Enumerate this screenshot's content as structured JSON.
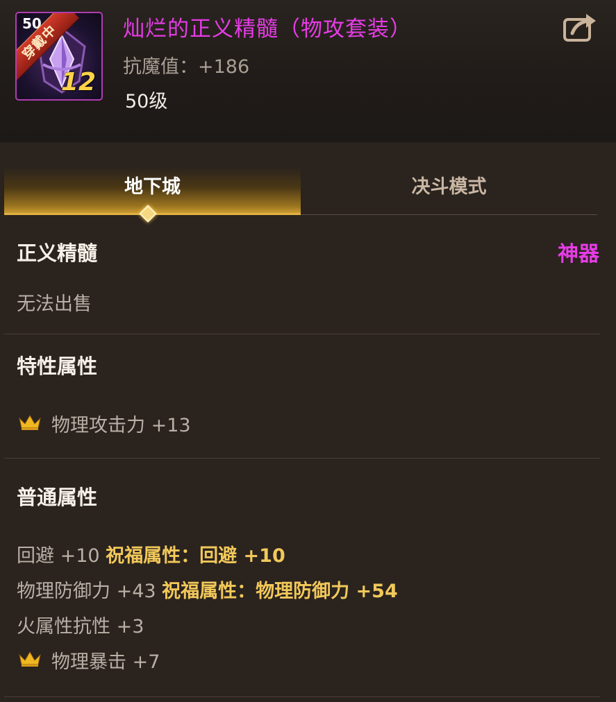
{
  "item": {
    "icon_level_top": "50",
    "equipped_badge": "穿戴中",
    "enhance_level": "12",
    "name": "灿烂的正义精髓（物攻套装）",
    "magic_resist": "抗魔值：+186",
    "required_level": "50级"
  },
  "tabs": [
    {
      "label": "地下城",
      "active": true
    },
    {
      "label": "决斗模式",
      "active": false
    }
  ],
  "detail": {
    "type_name": "正义精髓",
    "rarity": "神器",
    "sell_status": "无法出售"
  },
  "special_attributes": {
    "title": "特性属性",
    "items": [
      {
        "text": "物理攻击力 +13",
        "icon": "crown-icon"
      }
    ]
  },
  "normal_attributes": {
    "title": "普通属性",
    "rows": [
      {
        "base": "回避 +10",
        "bless": "祝福属性：回避 +10"
      },
      {
        "base": "物理防御力 +43",
        "bless": "祝福属性：物理防御力 +54"
      },
      {
        "base": "火属性抗性 +3",
        "bless": ""
      },
      {
        "base": "物理暴击 +7",
        "bless": "",
        "icon": "crown-icon"
      }
    ]
  },
  "colors": {
    "epic_name": "#e53ce5",
    "blessing": "#f2c85a",
    "active_tab": "#c89a30",
    "crown": "#f0b820"
  }
}
